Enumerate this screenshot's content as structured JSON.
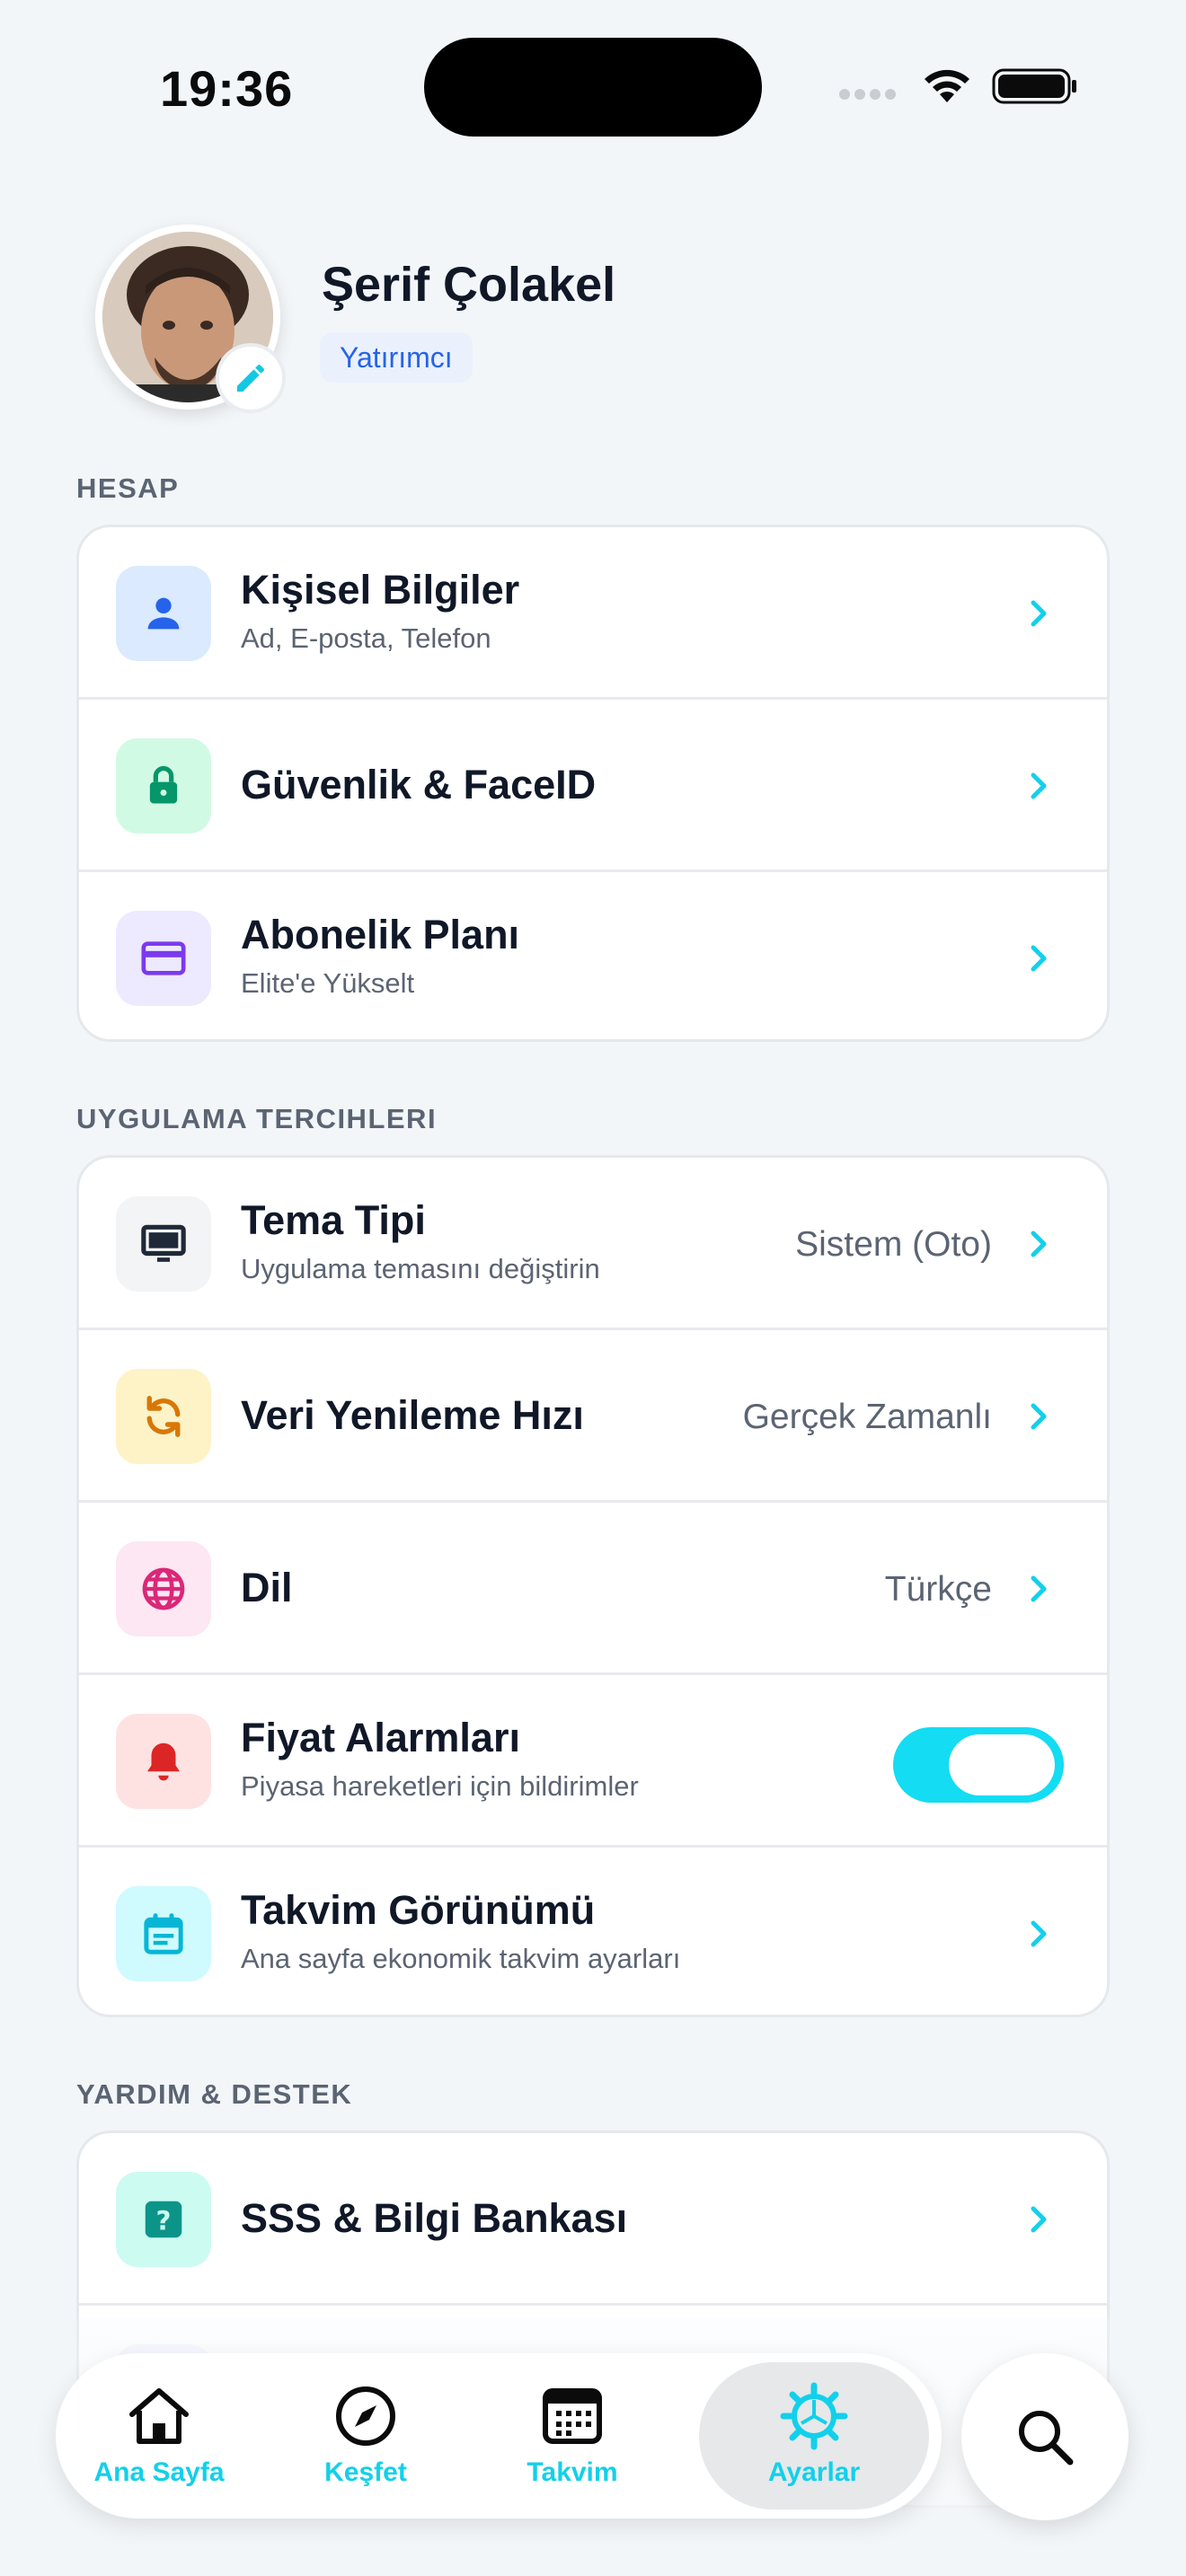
{
  "status_bar": {
    "time": "19:36"
  },
  "profile": {
    "name": "Şerif Çolakel",
    "role": "Yatırımcı"
  },
  "sections": {
    "account": {
      "title": "HESAP",
      "items": [
        {
          "title": "Kişisel Bilgiler",
          "subtitle": "Ad, E-posta, Telefon",
          "icon": "person-icon",
          "icon_color": "#2563eb",
          "icon_bg": "#dbeafe"
        },
        {
          "title": "Güvenlik & FaceID",
          "icon": "lock-icon",
          "icon_color": "#059669",
          "icon_bg": "#d1fae5"
        },
        {
          "title": "Abonelik Planı",
          "subtitle": "Elite'e Yükselt",
          "icon": "credit-card-icon",
          "icon_color": "#7c3aed",
          "icon_bg": "#ede9fe"
        }
      ]
    },
    "preferences": {
      "title": "UYGULAMA TERCIHLERI",
      "items": [
        {
          "title": "Tema Tipi",
          "subtitle": "Uygulama temasını değiştirin",
          "value": "Sistem (Oto)",
          "icon": "monitor-icon",
          "icon_color": "#1f2937",
          "icon_bg": "#f3f4f6"
        },
        {
          "title": "Veri Yenileme Hızı",
          "value": "Gerçek Zamanlı",
          "icon": "refresh-icon",
          "icon_color": "#d97706",
          "icon_bg": "#fef3c7"
        },
        {
          "title": "Dil",
          "value": "Türkçe",
          "icon": "globe-icon",
          "icon_color": "#db2777",
          "icon_bg": "#fce7f3"
        },
        {
          "title": "Fiyat Alarmları",
          "subtitle": "Piyasa hareketleri için bildirimler",
          "toggle_on": true,
          "icon": "bell-icon",
          "icon_color": "#dc2626",
          "icon_bg": "#fee2e2"
        },
        {
          "title": "Takvim Görünümü",
          "subtitle": "Ana sayfa ekonomik takvim ayarları",
          "icon": "calendar-icon",
          "icon_color": "#06b6d4",
          "icon_bg": "#cffafe"
        }
      ]
    },
    "support": {
      "title": "YARDIM & DESTEK",
      "items": [
        {
          "title": "SSS & Bilgi Bankası",
          "icon": "question-icon",
          "icon_color": "#0d9488",
          "icon_bg": "#ccfbf1"
        }
      ]
    }
  },
  "tabbar": {
    "accent": "#13d0ea",
    "tabs": [
      {
        "label": "Ana Sayfa",
        "icon": "home-icon"
      },
      {
        "label": "Keşfet",
        "icon": "compass-icon"
      },
      {
        "label": "Takvim",
        "icon": "calendar-icon"
      },
      {
        "label": "Ayarlar",
        "icon": "gear-icon",
        "active": true
      }
    ]
  }
}
